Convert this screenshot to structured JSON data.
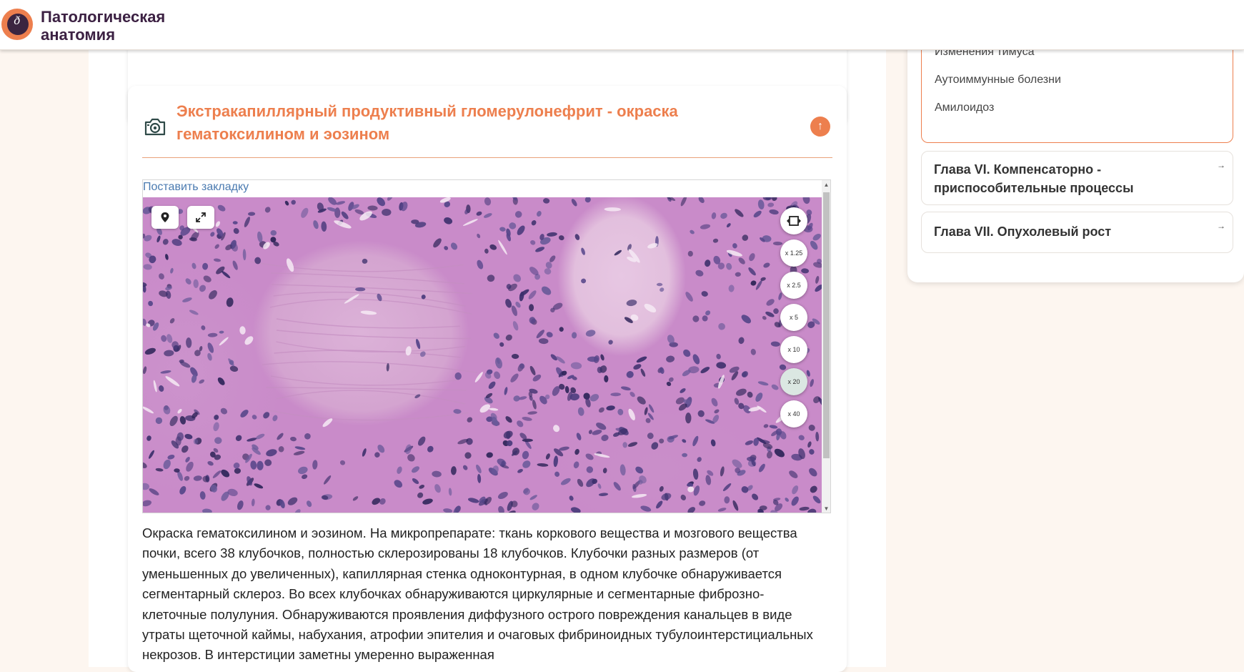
{
  "header": {
    "brand_title": "Патологическая анатомия"
  },
  "section": {
    "title": "Экстракапиллярный продуктивный гломерулонефрит - окраска гематоксилином и эозином",
    "bookmark_label": "Поставить закладку",
    "description": "Окраска гематоксилином и эозином. На микропрепарате: ткань коркового вещества и мозгового вещества почки, всего 38 клубочков, полностью склерозированы 18 клубочков. Клубочки разных размеров (от уменьшенных до увеличенных), капиллярная стенка одноконтурная, в одном клубочке обнаруживается сегментарный склероз. Во всех клубочках обнаруживаются циркулярные и сегментарные фиброзно-клеточные полулуния. Обнаруживаются проявления диффузного острого повреждения канальцев в виде утраты щеточной каймы, набухания, атрофии эпителия и очаговых фибриноидных тубулоинтерстициальных некрозов. В интерстиции заметны умеренно выраженная"
  },
  "viewer": {
    "zoom_levels": [
      "x 1.25",
      "x 2.5",
      "x 5",
      "x 10",
      "x 20",
      "x 40"
    ],
    "active_zoom": "x 20"
  },
  "sidebar": {
    "sub_items": [
      "Изменения тимуса",
      "Аутоиммунные болезни",
      "Амилоидоз"
    ],
    "chapters": [
      {
        "title": "Глава VI. Компенсаторно - приспособительные процессы"
      },
      {
        "title": "Глава VII. Опухолевый рост"
      }
    ]
  },
  "colors": {
    "accent": "#ed7f4e",
    "brand": "#3c2143",
    "link": "#4a7ab0"
  }
}
